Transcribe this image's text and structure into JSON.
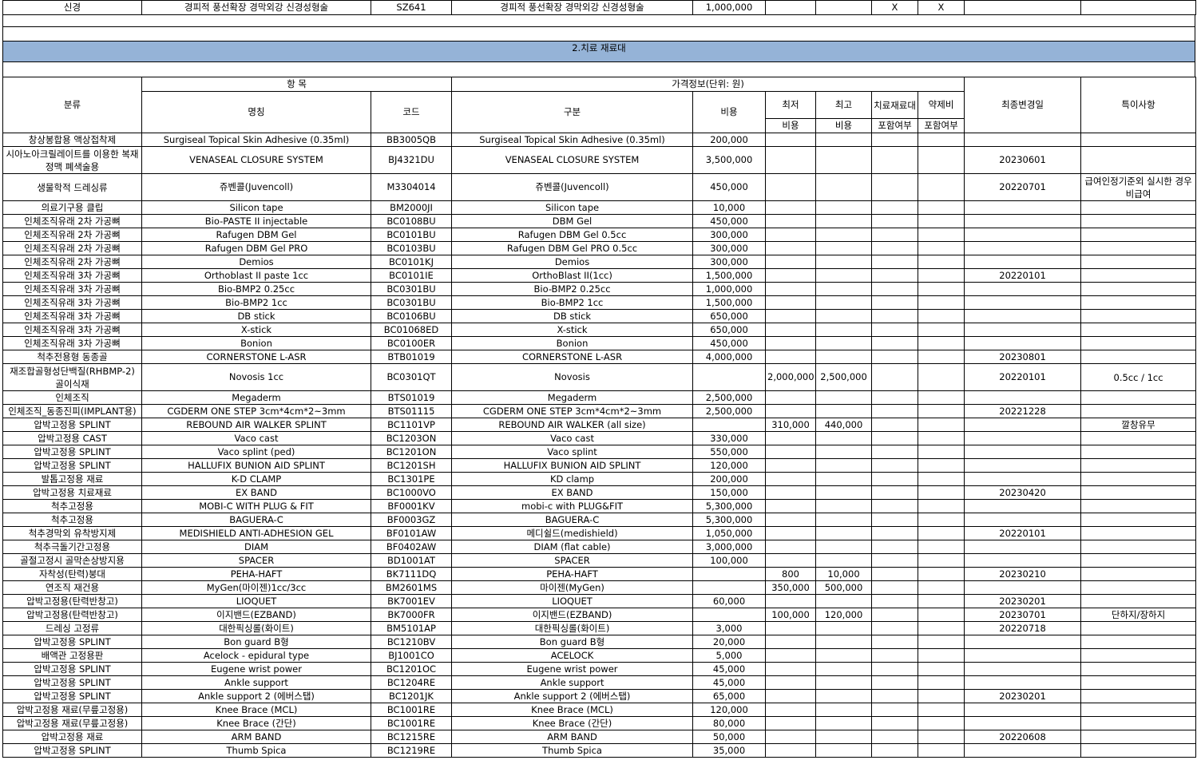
{
  "top_row": [
    "신경",
    "경피적 풍선확장 경막외강 신경성형술",
    "SZ641",
    "경피적 풍선확장 경막외강 신경성형술",
    "1,000,000",
    "",
    "",
    "X",
    "X",
    "",
    ""
  ],
  "section_title": "2.치료 재료대",
  "headers": {
    "category": "분류",
    "item_group": "항 목",
    "price_group": "가격정보(단위: 원)",
    "name": "명칭",
    "code": "코드",
    "division": "구분",
    "cost": "비용",
    "min": "최저",
    "max": "최고",
    "treatment_material": "치료재료대",
    "drug_cost": "약제비",
    "last_changed": "최종변경일",
    "notes": "특이사항",
    "min_sub": "비용",
    "max_sub": "비용",
    "treatment_sub": "포함여부",
    "drug_sub": "포함여부"
  },
  "rows": [
    [
      "창상봉합용 액상접착제",
      "Surgiseal Topical Skin Adhesive (0.35ml)",
      "BB3005QB",
      "Surgiseal Topical Skin Adhesive (0.35ml)",
      "200,000",
      "",
      "",
      "",
      "",
      "",
      ""
    ],
    [
      "시아노아크릴레이트를 이용한 복재정맥 폐색술용",
      "VENASEAL CLOSURE SYSTEM",
      "BJ4321DU",
      "VENASEAL CLOSURE SYSTEM",
      "3,500,000",
      "",
      "",
      "",
      "",
      "20230601",
      ""
    ],
    [
      "생물학적 드레싱류",
      "쥬벤콜(Juvencoll)",
      "M3304014",
      "쥬벤콜(Juvencoll)",
      "450,000",
      "",
      "",
      "",
      "",
      "20220701",
      "급여인정기준외 실시한 경우 비급여"
    ],
    [
      "의료기구용 클립",
      "Silicon tape",
      "BM2000JI",
      "Silicon tape",
      "10,000",
      "",
      "",
      "",
      "",
      "",
      ""
    ],
    [
      "인체조직유래 2차 가공뼈",
      "Bio-PASTE II injectable",
      "BC0108BU",
      "DBM Gel",
      "450,000",
      "",
      "",
      "",
      "",
      "",
      ""
    ],
    [
      "인체조직유래 2차 가공뼈",
      "Rafugen DBM Gel",
      "BC0101BU",
      "Rafugen DBM Gel 0.5cc",
      "300,000",
      "",
      "",
      "",
      "",
      "",
      ""
    ],
    [
      "인체조직유래 2차 가공뼈",
      "Rafugen DBM Gel PRO",
      "BC0103BU",
      "Rafugen DBM Gel PRO 0.5cc",
      "300,000",
      "",
      "",
      "",
      "",
      "",
      ""
    ],
    [
      "인체조직유래 2차 가공뼈",
      "Demios",
      "BC0101KJ",
      "Demios",
      "300,000",
      "",
      "",
      "",
      "",
      "",
      ""
    ],
    [
      "인체조직유래 3차 가공뼈",
      "Orthoblast II paste 1cc",
      "BC0101IE",
      "OrthoBlast II(1cc)",
      "1,500,000",
      "",
      "",
      "",
      "",
      "20220101",
      ""
    ],
    [
      "인체조직유래 3차 가공뼈",
      "Bio-BMP2 0.25cc",
      "BC0301BU",
      "Bio-BMP2 0.25cc",
      "1,000,000",
      "",
      "",
      "",
      "",
      "",
      ""
    ],
    [
      "인체조직유래 3차 가공뼈",
      "Bio-BMP2 1cc",
      "BC0301BU",
      "Bio-BMP2 1cc",
      "1,500,000",
      "",
      "",
      "",
      "",
      "",
      ""
    ],
    [
      "인체조직유래 3차 가공뼈",
      "DB stick",
      "BC0106BU",
      "DB stick",
      "650,000",
      "",
      "",
      "",
      "",
      "",
      ""
    ],
    [
      "인체조직유래 3차 가공뼈",
      "X-stick",
      "BC01068ED",
      "X-stick",
      "650,000",
      "",
      "",
      "",
      "",
      "",
      ""
    ],
    [
      "인체조직유래 3차 가공뼈",
      "Bonion",
      "BC0100ER",
      "Bonion",
      "450,000",
      "",
      "",
      "",
      "",
      "",
      ""
    ],
    [
      "척추전용형 동종골",
      "CORNERSTONE L-ASR",
      "BTB01019",
      "CORNERSTONE L-ASR",
      "4,000,000",
      "",
      "",
      "",
      "",
      "20230801",
      ""
    ],
    [
      "재조합골형성단백질(RHBMP-2) 골이식재",
      "Novosis 1cc",
      "BC0301QT",
      "Novosis",
      "",
      "2,000,000",
      "2,500,000",
      "",
      "",
      "20220101",
      "0.5cc / 1cc"
    ],
    [
      "인체조직",
      "Megaderm",
      "BTS01019",
      "Megaderm",
      "2,500,000",
      "",
      "",
      "",
      "",
      "",
      ""
    ],
    [
      "인체조직_동종진피(IMPLANT용)",
      "CGDERM ONE STEP 3cm*4cm*2~3mm",
      "BTS01115",
      "CGDERM ONE STEP 3cm*4cm*2~3mm",
      "2,500,000",
      "",
      "",
      "",
      "",
      "20221228",
      ""
    ],
    [
      "압박고정용 SPLINT",
      "REBOUND AIR WALKER SPLINT",
      "BC1101VP",
      "REBOUND AIR WALKER (all size)",
      "",
      "310,000",
      "440,000",
      "",
      "",
      "",
      "깔창유무"
    ],
    [
      "압박고정용 CAST",
      "Vaco cast",
      "BC1203ON",
      "Vaco cast",
      "330,000",
      "",
      "",
      "",
      "",
      "",
      ""
    ],
    [
      "압박고정용 SPLINT",
      "Vaco splint (ped)",
      "BC1201ON",
      "Vaco splint",
      "550,000",
      "",
      "",
      "",
      "",
      "",
      ""
    ],
    [
      "압박고정용 SPLINT",
      "HALLUFIX BUNION AID SPLINT",
      "BC1201SH",
      "HALLUFIX BUNION AID SPLINT",
      "120,000",
      "",
      "",
      "",
      "",
      "",
      ""
    ],
    [
      "발톱고정용 재료",
      "K-D CLAMP",
      "BC1301PE",
      "KD clamp",
      "200,000",
      "",
      "",
      "",
      "",
      "",
      ""
    ],
    [
      "압박고정용 치료재료",
      "EX BAND",
      "BC1000VO",
      "EX BAND",
      "150,000",
      "",
      "",
      "",
      "",
      "20230420",
      ""
    ],
    [
      "척추고정용",
      "MOBI-C WITH PLUG & FIT",
      "BF0001KV",
      "mobi-c with PLUG&FIT",
      "5,300,000",
      "",
      "",
      "",
      "",
      "",
      ""
    ],
    [
      "척추고정용",
      "BAGUERA-C",
      "BF0003GZ",
      "BAGUERA-C",
      "5,300,000",
      "",
      "",
      "",
      "",
      "",
      ""
    ],
    [
      "척추경막외 유착방지제",
      "MEDISHIELD ANTI-ADHESION GEL",
      "BF0101AW",
      "메디쉴드(medishield)",
      "1,050,000",
      "",
      "",
      "",
      "",
      "20220101",
      ""
    ],
    [
      "척추극돌기간고정용",
      "DIAM",
      "BF0402AW",
      "DIAM (flat cable)",
      "3,000,000",
      "",
      "",
      "",
      "",
      "",
      ""
    ],
    [
      "골절고정시 골막손상방지용",
      "SPACER",
      "BD1001AT",
      "SPACER",
      "100,000",
      "",
      "",
      "",
      "",
      "",
      ""
    ],
    [
      "자착성(탄력)붕대",
      "PEHA-HAFT",
      "BK7111DQ",
      "PEHA-HAFT",
      "",
      "800",
      "10,000",
      "",
      "",
      "20230210",
      ""
    ],
    [
      "연조직 재건용",
      "MyGen(마이젠)1cc/3cc",
      "BM2601MS",
      "마이젠(MyGen)",
      "",
      "350,000",
      "500,000",
      "",
      "",
      "",
      ""
    ],
    [
      "압박고정용(탄력반창고)",
      "LIOQUET",
      "BK7001EV",
      "LIOQUET",
      "60,000",
      "",
      "",
      "",
      "",
      "20230201",
      ""
    ],
    [
      "압박고정용(탄력반창고)",
      "이지밴드(EZBAND)",
      "BK7000FR",
      "이지밴드(EZBAND)",
      "",
      "100,000",
      "120,000",
      "",
      "",
      "20230701",
      "단하지/장하지"
    ],
    [
      "드레싱 고정류",
      "대한픽싱롤(화이트)",
      "BM5101AP",
      "대한픽싱롤(화이트)",
      "3,000",
      "",
      "",
      "",
      "",
      "20220718",
      ""
    ],
    [
      "압박고정용 SPLINT",
      "Bon guard B형",
      "BC1210BV",
      "Bon guard B형",
      "20,000",
      "",
      "",
      "",
      "",
      "",
      ""
    ],
    [
      "배액관 고정용판",
      "Acelock - epidural type",
      "BJ1001CO",
      "ACELOCK",
      "5,000",
      "",
      "",
      "",
      "",
      "",
      ""
    ],
    [
      "압박고정용 SPLINT",
      "Eugene wrist power",
      "BC1201OC",
      "Eugene wrist power",
      "45,000",
      "",
      "",
      "",
      "",
      "",
      ""
    ],
    [
      "압박고정용 SPLINT",
      "Ankle support",
      "BC1204RE",
      "Ankle support",
      "45,000",
      "",
      "",
      "",
      "",
      "",
      ""
    ],
    [
      "압박고정용 SPLINT",
      "Ankle support 2 (에버스탭)",
      "BC1201JK",
      "Ankle support 2 (에버스탭)",
      "65,000",
      "",
      "",
      "",
      "",
      "20230201",
      ""
    ],
    [
      "압박고정용 재료(무릎고정용)",
      "Knee Brace (MCL)",
      "BC1001RE",
      "Knee Brace (MCL)",
      "120,000",
      "",
      "",
      "",
      "",
      "",
      ""
    ],
    [
      "압박고정용 재료(무릎고정용)",
      "Knee Brace (간단)",
      "BC1001RE",
      "Knee Brace (간단)",
      "80,000",
      "",
      "",
      "",
      "",
      "",
      ""
    ],
    [
      "압박고정용 재료",
      "ARM BAND",
      "BC1215RE",
      "ARM BAND",
      "50,000",
      "",
      "",
      "",
      "",
      "20220608",
      ""
    ],
    [
      "압박고정용 SPLINT",
      "Thumb Spica",
      "BC1219RE",
      "Thumb Spica",
      "35,000",
      "",
      "",
      "",
      "",
      "",
      ""
    ]
  ],
  "colors": {
    "section_bar": "#95b3d7",
    "grid": "#000000"
  }
}
